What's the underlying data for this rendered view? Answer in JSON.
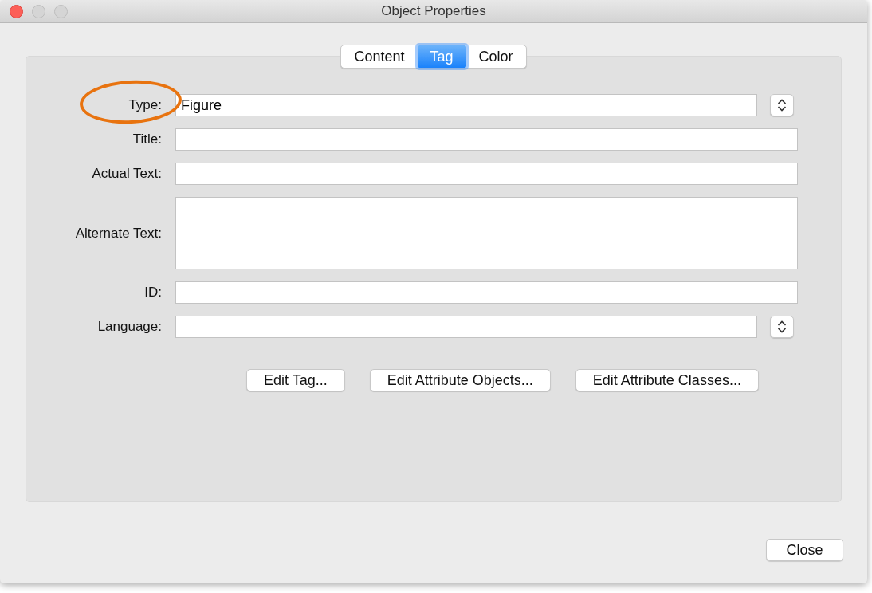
{
  "window": {
    "title": "Object Properties"
  },
  "tabs": [
    {
      "label": "Content",
      "selected": false
    },
    {
      "label": "Tag",
      "selected": true
    },
    {
      "label": "Color",
      "selected": false
    }
  ],
  "fields": [
    {
      "kind": "select",
      "label": "Type:",
      "value": "Figure"
    },
    {
      "kind": "text",
      "label": "Title:"
    },
    {
      "kind": "text",
      "label": "Actual Text:"
    },
    {
      "kind": "textarea",
      "label": "Alternate Text:"
    },
    {
      "kind": "text",
      "label": "ID:"
    },
    {
      "kind": "select",
      "label": "Language:"
    }
  ],
  "buttons": [
    "Edit Tag...",
    "Edit Attribute Objects...",
    "Edit Attribute Classes..."
  ],
  "close_button": "Close"
}
